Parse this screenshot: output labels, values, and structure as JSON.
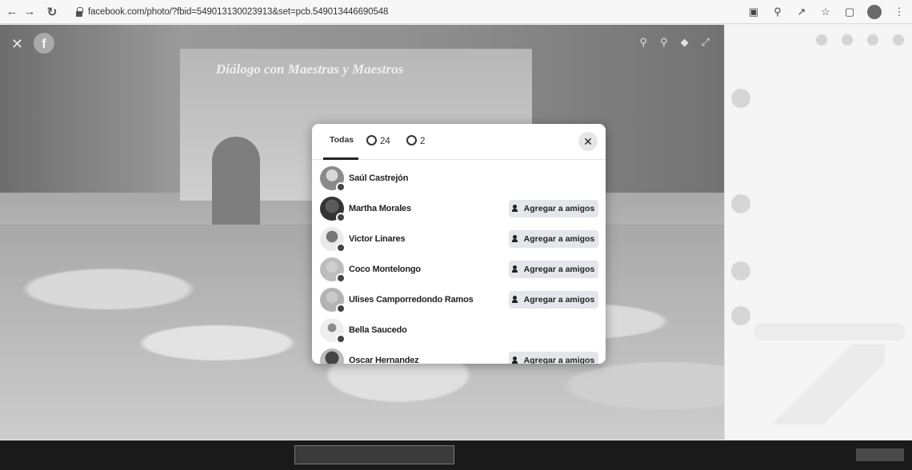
{
  "browser": {
    "url": "facebook.com/photo/?fbid=549013130023913&set=pcb.549013446690548"
  },
  "photo": {
    "logo_letter": "f",
    "banner_text": "Diálogo con Maestras y Maestros"
  },
  "reactions_modal": {
    "tabs": [
      {
        "label": "Todas"
      },
      {
        "label": "24",
        "icon": "like-reaction-icon"
      },
      {
        "label": "2",
        "icon": "love-reaction-icon"
      }
    ],
    "people": [
      {
        "name": "Saúl Castrejón",
        "add_button": ""
      },
      {
        "name": "Martha Morales",
        "add_button": "Agregar a amigos"
      },
      {
        "name": "Victor Linares",
        "add_button": "Agregar a amigos"
      },
      {
        "name": "Coco Montelongo",
        "add_button": "Agregar a amigos"
      },
      {
        "name": "Ulises Camporredondo Ramos",
        "add_button": "Agregar a amigos"
      },
      {
        "name": "Bella Saucedo",
        "add_button": ""
      },
      {
        "name": "Oscar Hernandez",
        "add_button": "Agregar a amigos"
      }
    ]
  },
  "icons": {
    "close": "close-icon",
    "add_friend": "add-friend-icon",
    "lock": "lock-icon"
  },
  "colors": {
    "add_button_bg": "#e4e6eb",
    "modal_bg": "#ffffff"
  }
}
